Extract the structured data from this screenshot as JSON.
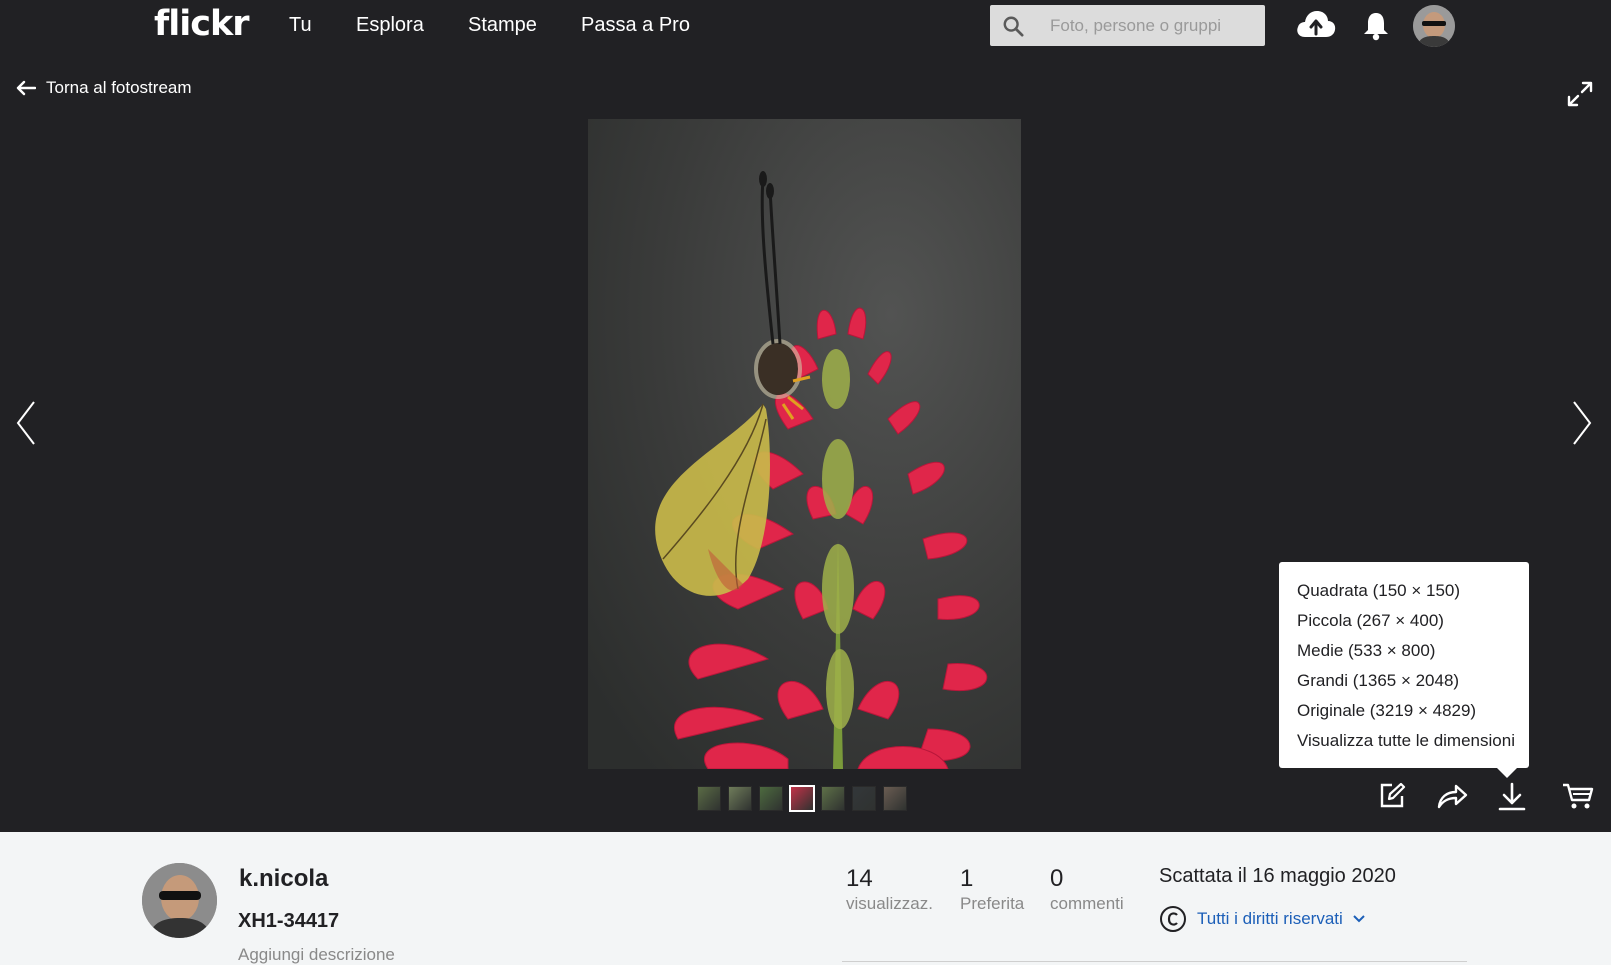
{
  "topbar": {
    "logo": "flickr",
    "nav": [
      "Tu",
      "Esplora",
      "Stampe",
      "Passa a Pro"
    ],
    "search_placeholder": "Foto, persone o gruppi",
    "icons": [
      "search-icon",
      "upload-cloud-icon",
      "notification-bell-icon",
      "user-avatar"
    ]
  },
  "viewer": {
    "back_label": "Torna al fotostream",
    "thumbnail_count": 7,
    "active_thumbnail": 4,
    "thumb_colors": [
      "#5a6b45",
      "#6f7c5a",
      "#4d6a3f",
      "#c23248",
      "#5e7048",
      "#33373a",
      "#6a5c52"
    ]
  },
  "download_menu": {
    "items": [
      "Quadrata (150 × 150)",
      "Piccola (267 × 400)",
      "Medie (533 × 800)",
      "Grandi (1365 × 2048)",
      "Originale (3219 × 4829)",
      "Visualizza tutte le dimensioni"
    ]
  },
  "info": {
    "owner": "k.nicola",
    "title": "XH1-34417",
    "add_description": "Aggiungi descrizione",
    "stats": [
      {
        "value": "14",
        "label": "visualizzaz."
      },
      {
        "value": "1",
        "label": "Preferita"
      },
      {
        "value": "0",
        "label": "commenti"
      }
    ],
    "taken": "Scattata il 16 maggio 2020",
    "license": "Tutti i diritti riservati"
  },
  "colors": {
    "background": "#212124",
    "panel": "#f3f5f6",
    "link": "#1c5fb8",
    "flower": "#e0264a"
  }
}
